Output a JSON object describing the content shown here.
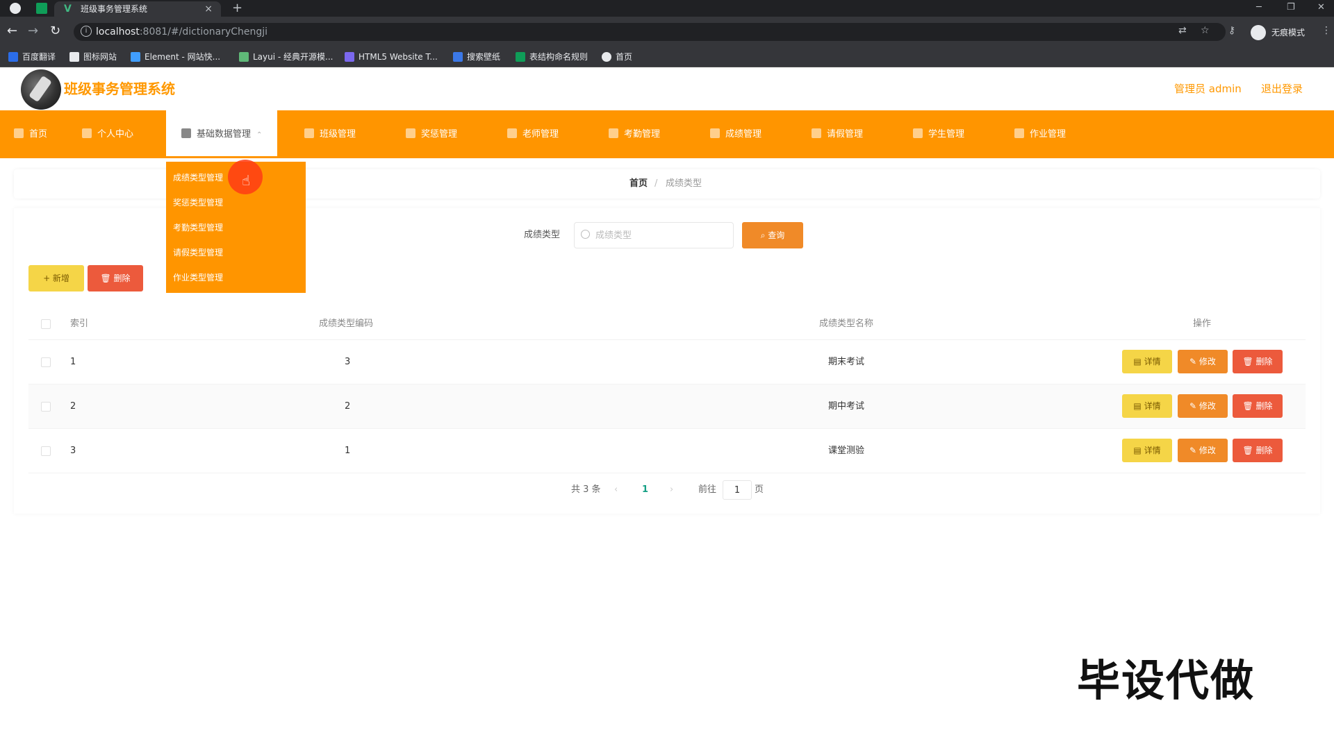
{
  "browser": {
    "tab_title": "班级事务管理系统",
    "tab_close": "×",
    "new_tab": "+",
    "url_host": "localhost",
    "url_rest": ":8081/#/dictionaryChengji",
    "incognito_label": "无痕模式",
    "bookmarks": [
      "百度翻译",
      "图标网站",
      "Element - 网站快...",
      "Layui - 经典开源模...",
      "HTML5 Website T...",
      "搜索壁纸",
      "表结构命名规则",
      "首页"
    ]
  },
  "header": {
    "title": "班级事务管理系统",
    "user": "管理员 admin",
    "logout": "退出登录"
  },
  "menu": {
    "items": [
      "首页",
      "个人中心",
      "基础数据管理",
      "班级管理",
      "奖惩管理",
      "老师管理",
      "考勤管理",
      "成绩管理",
      "请假管理",
      "学生管理",
      "作业管理"
    ],
    "active_index": 2,
    "dropdown": [
      "成绩类型管理",
      "奖惩类型管理",
      "考勤类型管理",
      "请假类型管理",
      "作业类型管理"
    ]
  },
  "breadcrumb": {
    "home": "首页",
    "separator": "/",
    "current": "成绩类型"
  },
  "search": {
    "label": "成绩类型",
    "placeholder": "成绩类型",
    "query_button": "查询"
  },
  "toolbar": {
    "add": "+ 新增",
    "delete": "删除"
  },
  "table": {
    "columns": [
      "索引",
      "成绩类型编码",
      "成绩类型名称",
      "操作"
    ],
    "rows": [
      {
        "index": "1",
        "code": "3",
        "name": "期末考试"
      },
      {
        "index": "2",
        "code": "2",
        "name": "期中考试"
      },
      {
        "index": "3",
        "code": "1",
        "name": "课堂测验"
      }
    ],
    "actions": {
      "detail": "详情",
      "edit": "修改",
      "delete": "删除"
    }
  },
  "pagination": {
    "total": "共 3 条",
    "prev": "‹",
    "current": "1",
    "next": "›",
    "goto_prefix": "前往",
    "goto_value": "1",
    "goto_suffix": "页"
  },
  "watermark": "毕设代做",
  "colors": {
    "accent": "#ff9500",
    "danger": "#ec5a3c",
    "warning": "#f5d547",
    "edit": "#f08a28"
  }
}
